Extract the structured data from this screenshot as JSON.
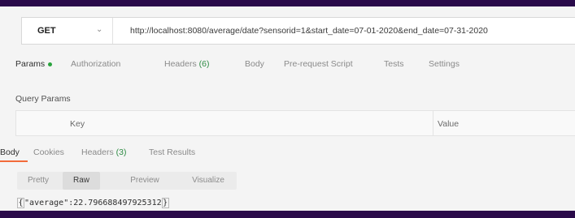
{
  "request": {
    "method": "GET",
    "url": "http://localhost:8080/average/date?sensorid=1&start_date=07-01-2020&end_date=07-31-2020"
  },
  "request_tabs": [
    {
      "label": "Params",
      "active": true
    },
    {
      "label": "Authorization"
    },
    {
      "label": "Headers",
      "count": "(6)"
    },
    {
      "label": "Body"
    },
    {
      "label": "Pre-request Script"
    },
    {
      "label": "Tests"
    },
    {
      "label": "Settings"
    }
  ],
  "query_params": {
    "title": "Query Params",
    "columns": {
      "key": "Key",
      "value": "Value"
    }
  },
  "response_tabs": [
    {
      "label": "Body",
      "active": true
    },
    {
      "label": "Cookies"
    },
    {
      "label": "Headers",
      "count": "(3)"
    },
    {
      "label": "Test Results"
    }
  ],
  "view_modes": [
    {
      "label": "Pretty"
    },
    {
      "label": "Raw",
      "active": true
    },
    {
      "label": "Preview"
    },
    {
      "label": "Visualize"
    }
  ],
  "response": {
    "open": "{",
    "body": "\"average\":22.796688497925312",
    "close": "}"
  },
  "colors": {
    "background": "#2a0a4a",
    "active_dot": "#29a33d",
    "active_underline": "#f26b3a"
  }
}
